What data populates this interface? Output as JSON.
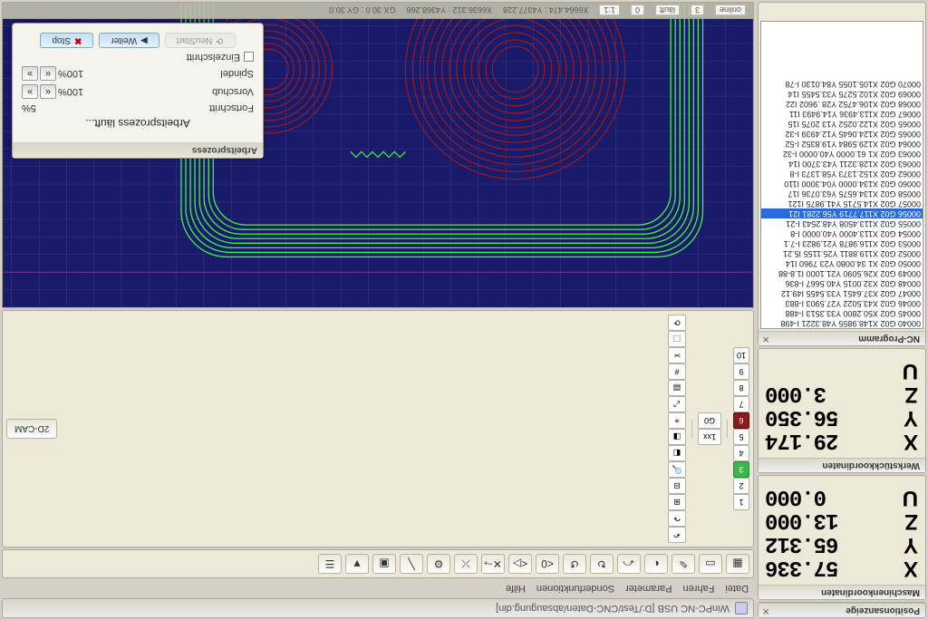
{
  "app": {
    "title": "WinPC-NC USB [D:/Test/CNC-Daten/absaugung.din]"
  },
  "menu": [
    "Datei",
    "Fahren",
    "Parameter",
    "Sonderfunktionen",
    "Hilfe"
  ],
  "position_panel": "Positionsanzeige",
  "machine_panel": "Maschinenkoordinaten",
  "work_panel": "Werkstückkoordinaten",
  "nc_panel": "NC-Programm",
  "machine": {
    "X": "57.336",
    "Y": "65.312",
    "Z": "13.000",
    "U": "0.000"
  },
  "work": {
    "X": "29.174",
    "Y": "56.350",
    "Z": "3.000",
    "U": ""
  },
  "status": {
    "online": "online",
    "num": "3",
    "state": "läuft",
    "zero": "0",
    "scale": "1:1",
    "cursor": "X6664.474 : Y4377.228",
    "origin": "X6636.312 : Y4368.266",
    "grid": "GX 30.0 : GY 30.0"
  },
  "toolbar_nums": [
    "1",
    "2",
    "3",
    "4",
    "5",
    "6",
    "7",
    "8",
    "9",
    "10"
  ],
  "toolbar_active_green": 2,
  "toolbar_active_red": 5,
  "toolbar_end": [
    "1xx",
    "G0"
  ],
  "big_toolbar_glyphs": [
    "▦",
    "▭",
    "✎",
    "◐",
    "⤺",
    "↻",
    "↺",
    "<0",
    "<▷",
    "✕⤳",
    "⤫",
    "⚙",
    "╲",
    "▣",
    "▼",
    "☰"
  ],
  "right_toolbar_glyphs": [
    "↶",
    "↷",
    "⊞",
    "⊟",
    "🔍",
    "◧",
    "◨",
    "⌖",
    "⤢",
    "▤",
    "#",
    "✂",
    "⬚",
    "⟳"
  ],
  "cam_button": "2D-CAM",
  "proc": {
    "title": "Arbeitsprozess",
    "message": "Arbeitsprozess läuft...",
    "progress_label": "Fortschritt",
    "progress_value": "5%",
    "feed_label": "Vorschub",
    "feed_value": "100%",
    "spindle_label": "Spindel",
    "spindle_value": "100%",
    "single_step": "Einzelschritt",
    "btn_restart": "NeuStart",
    "btn_continue": "Weiter",
    "btn_stop": "Stop"
  },
  "nc_lines": [
    "00040  G02 X148.9855 Y48.3221 I-498",
    "00045  G02 X50.2800 Y33.3513 I-488",
    "00046  G02 X43.5022 Y27.5903 I-883",
    "00047  G02 X37.6451 Y33.5455 I49.12",
    "00048  G02 X32.0015 Y40.5667 I-836",
    "00049  G02 X26.5090 Y21.1000 I1.8-88",
    "00050  G02 X1 34.0080 Y23 7960 I14",
    "00052  G02 X119.8811 Y25.1155 I5.21",
    "00053  G02 X116.9878 Y21.9823 I-7.1",
    "00054  G02 X113.4000 Y40.0000 I-8",
    "00055  G02 X113.4508 Y48.2543 I-21",
    "00056  G02 X117.7719 Y56.2281 I21",
    "00057  G02 X14.5715 Y41.9875 I121",
    "00058  G02 X134.6575 Y63.0736 I17",
    "00060  G02 X134.0000 Y04.3000 I110",
    "00062  G02 X152.1373 Y58.1373 I-8",
    "00063  G02 X128.3211 Y43.3700 I14",
    "00063  G02 X1 61.0000 Y40.0000 I-32",
    "00064  G02 X129.5984 Y19.8352 I-52",
    "00065  G02 X124.0645 Y12.4939 I-32",
    "00065  G02 X122.0252 Y13 2075 I15",
    "00067  G02 X113.4936 Y14.9493 I11",
    "00068  G02 X106.4752 Y28 .9602 I22",
    "00069  G02 X102.5275 Y33.5455 I14",
    "00070  G02 X105.1055 Y84.0130 I-78"
  ],
  "nc_selected_index": 11
}
